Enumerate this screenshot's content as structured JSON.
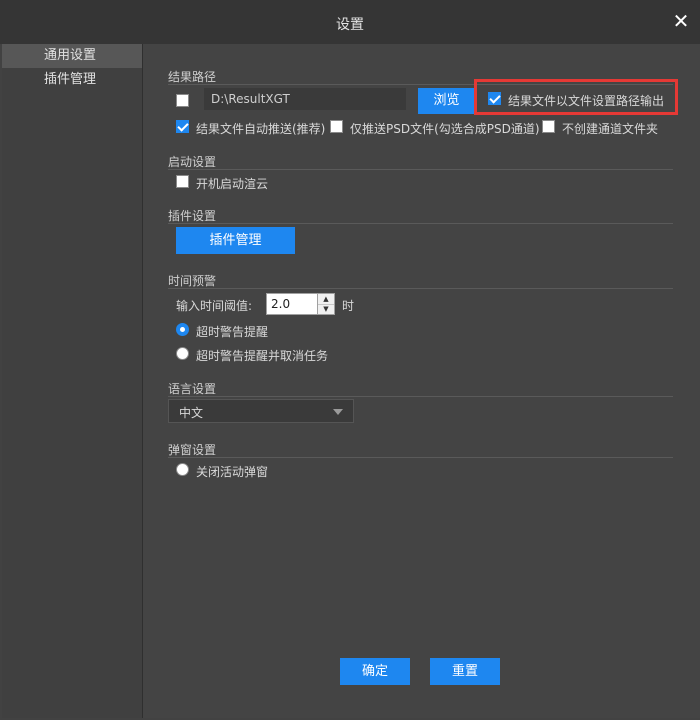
{
  "window": {
    "title": "设置",
    "close_icon": "✕"
  },
  "sidebar": {
    "items": [
      {
        "label": "通用设置",
        "active": true
      },
      {
        "label": "插件管理",
        "active": false
      }
    ]
  },
  "sections": {
    "result_path": {
      "title": "结果路径",
      "path_value": "D:\\ResultXGT",
      "browse_label": "浏览",
      "use_file_setting_path_label": "结果文件以文件设置路径输出",
      "auto_push_label": "结果文件自动推送(推荐)",
      "psd_only_label": "仅推送PSD文件(勾选合成PSD通道)",
      "no_channel_folder_label": "不创建通道文件夹"
    },
    "startup": {
      "title": "启动设置",
      "auto_start_label": "开机启动渲云"
    },
    "plugin": {
      "title": "插件设置",
      "manage_button": "插件管理"
    },
    "timeout": {
      "title": "时间预警",
      "input_label": "输入时间阈值:",
      "value": "2.0",
      "unit": "时",
      "up_icon": "▲",
      "down_icon": "▼",
      "opt_warn": "超时警告提醒",
      "opt_warn_cancel": "超时警告提醒并取消任务"
    },
    "language": {
      "title": "语言设置",
      "selected": "中文"
    },
    "popup": {
      "title": "弹窗设置",
      "close_popup_label": "关闭活动弹窗"
    }
  },
  "footer": {
    "confirm": "确定",
    "reset": "重置"
  },
  "colors": {
    "accent": "#1e87f0",
    "highlight": "#e53935"
  }
}
